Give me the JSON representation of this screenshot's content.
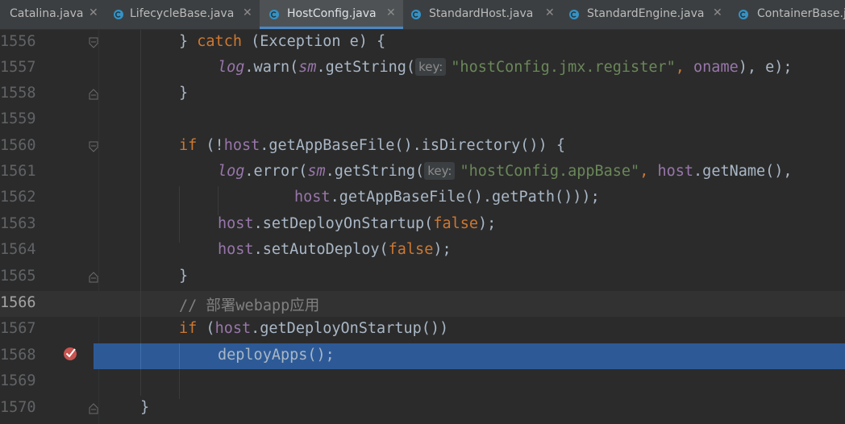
{
  "tabs": [
    {
      "label": "Catalina.java",
      "active": false
    },
    {
      "label": "LifecycleBase.java",
      "active": false
    },
    {
      "label": "HostConfig.java",
      "active": true
    },
    {
      "label": "StandardHost.java",
      "active": false
    },
    {
      "label": "StandardEngine.java",
      "active": false
    },
    {
      "label": "ContainerBase.java",
      "active": false
    }
  ],
  "tab_icon": "java-class-icon",
  "tab_close_glyph": "✕",
  "colors": {
    "background": "#2b2b2b",
    "keyword": "#cc7832",
    "field": "#9876aa",
    "string": "#6a8759",
    "comment": "#808080",
    "execution_line": "#2d5a97",
    "breakpoint": "#c75450"
  },
  "editor": {
    "current_line": 1566,
    "execution_line": 1568,
    "breakpoint_line": 1568,
    "lines": [
      {
        "num": "1556",
        "t1": "} ",
        "kw1": "catch",
        "t2": " (Exception e) {"
      },
      {
        "num": "1557",
        "log": "log",
        "warn": ".warn(",
        "sm": "sm",
        "gs": ".getString(",
        "hint": "key:",
        "str": "\"hostConfig.jmx.register\"",
        "sep": ", ",
        "oname": "oname",
        "tail": "), e);"
      },
      {
        "num": "1558",
        "t1": "}"
      },
      {
        "num": "1559"
      },
      {
        "num": "1560",
        "kw1": "if",
        "t2": " (!",
        "host": "host",
        "t3": ".getAppBaseFile().isDirectory()) {"
      },
      {
        "num": "1561",
        "log": "log",
        "err": ".error(",
        "sm": "sm",
        "gs": ".getString(",
        "hint": "key:",
        "str": "\"hostConfig.appBase\"",
        "sep": ", ",
        "host": "host",
        "tail": ".getName(),"
      },
      {
        "num": "1562",
        "host": "host",
        "tail": ".getAppBaseFile().getPath()));"
      },
      {
        "num": "1563",
        "host": "host",
        "call": ".setDeployOnStartup(",
        "val": "false",
        "tail": ");"
      },
      {
        "num": "1564",
        "host": "host",
        "call": ".setAutoDeploy(",
        "val": "false",
        "tail": ");"
      },
      {
        "num": "1565",
        "t1": "}"
      },
      {
        "num": "1566",
        "comment": "// 部署webapp应用"
      },
      {
        "num": "1567",
        "kw1": "if",
        "t2": " (",
        "host": "host",
        "t3": ".getDeployOnStartup())"
      },
      {
        "num": "1568",
        "t1": "deployApps();"
      },
      {
        "num": "1569"
      },
      {
        "num": "1570",
        "t1": "}"
      }
    ]
  }
}
